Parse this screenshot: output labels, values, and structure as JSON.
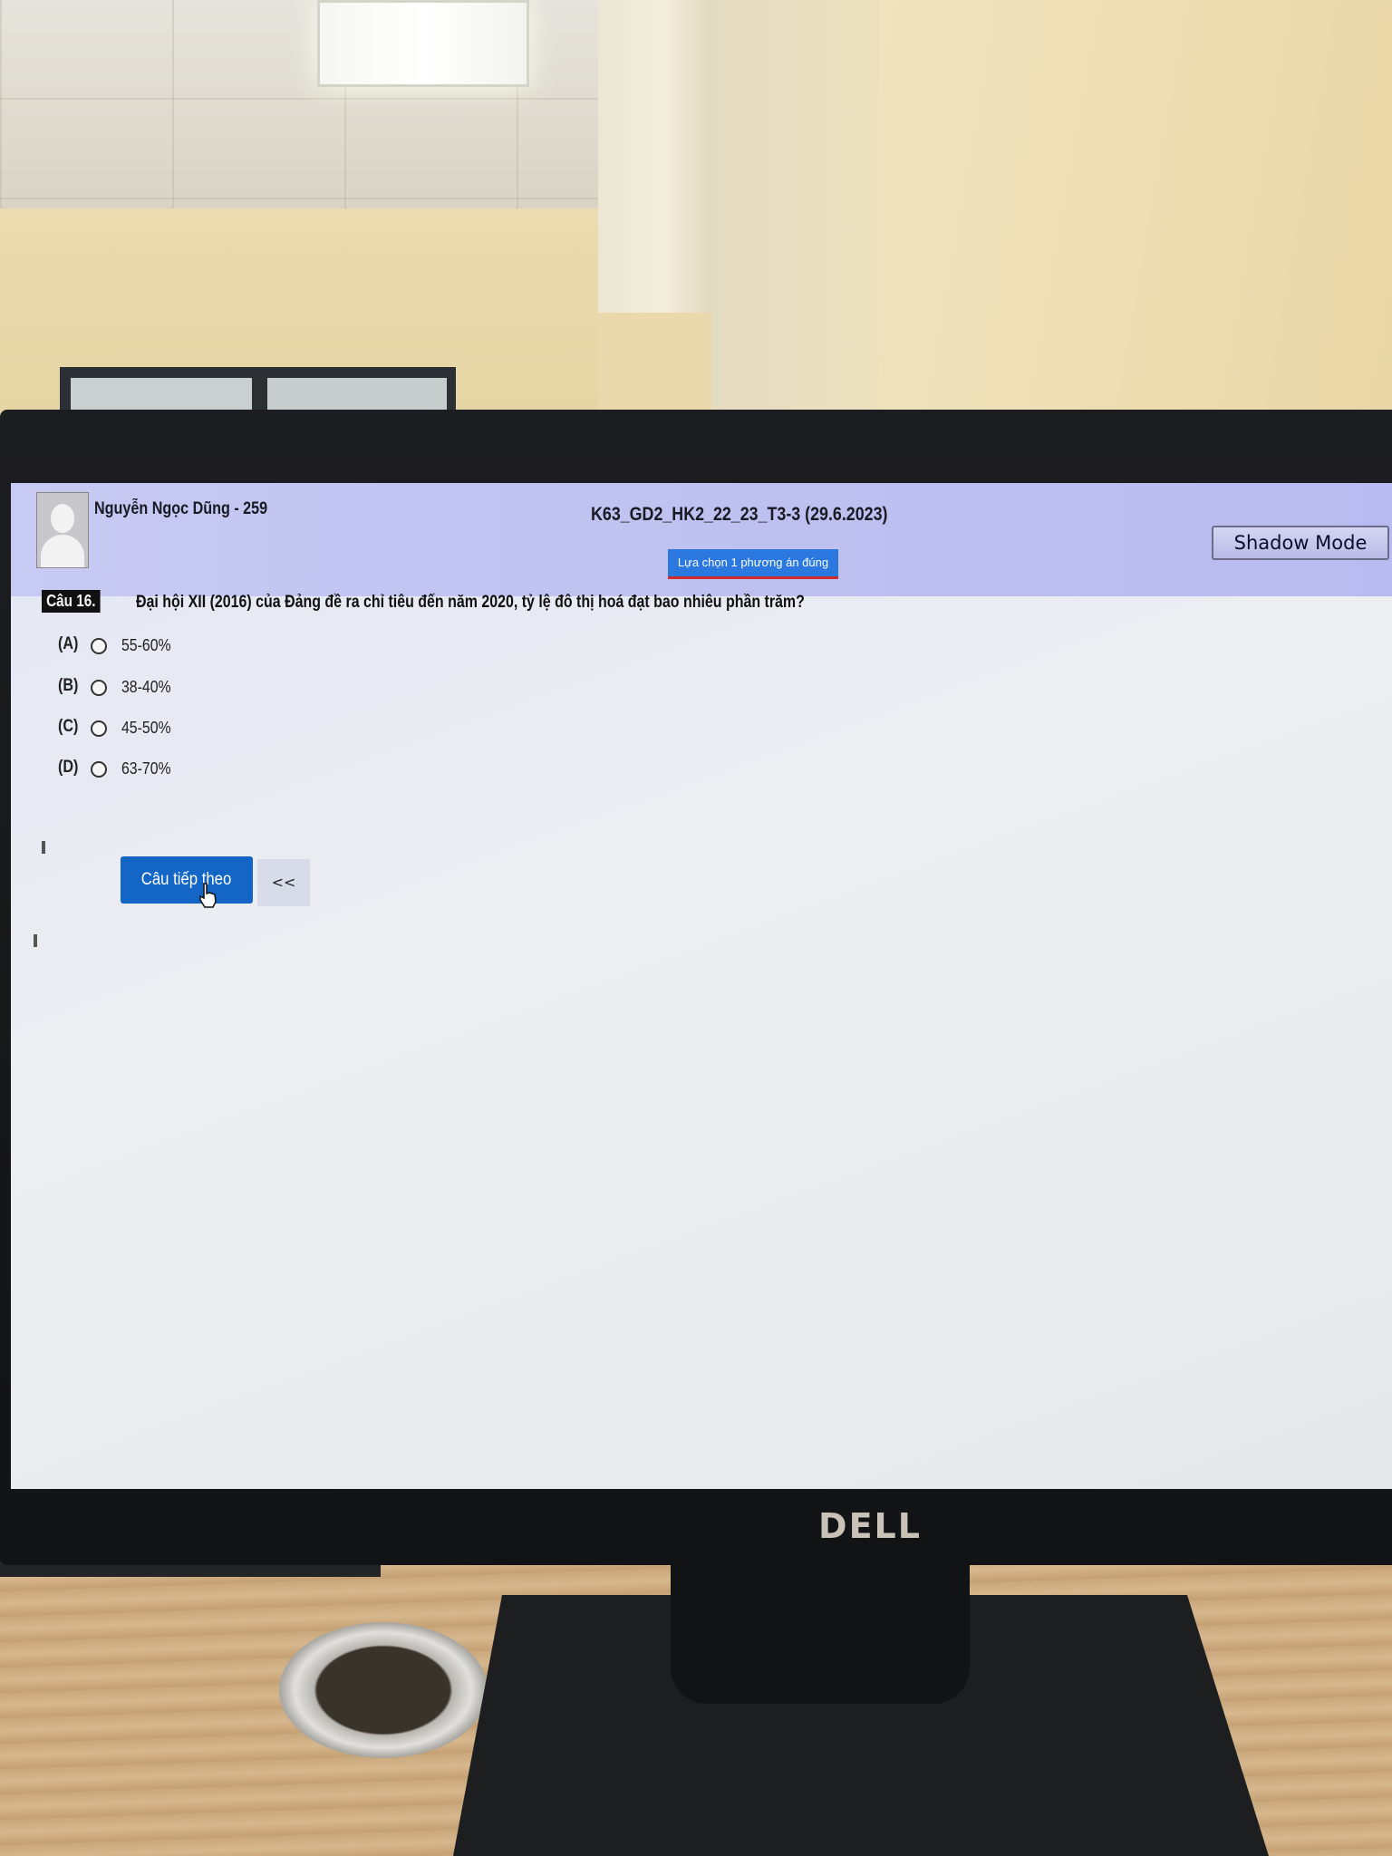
{
  "header": {
    "user_name": "Nguyễn Ngọc Dũng - 259",
    "exam_title": "K63_GD2_HK2_22_23_T3-3 (29.6.2023)",
    "instruction": "Lựa chọn 1 phương án đúng",
    "shadow_mode_label": "Shadow Mode"
  },
  "question": {
    "number_label": "Câu 16.",
    "text": "Đại hội XII (2016) của Đảng đề ra chỉ tiêu đến năm 2020, tỷ lệ đô thị hoá đạt bao nhiêu phần trăm?",
    "options": [
      {
        "letter": "(A)",
        "value": "55-60%"
      },
      {
        "letter": "(B)",
        "value": "38-40%"
      },
      {
        "letter": "(C)",
        "value": "45-50%"
      },
      {
        "letter": "(D)",
        "value": "63-70%"
      }
    ]
  },
  "navigation": {
    "next_label": "Câu tiếp theo",
    "prev_label": "<<"
  },
  "monitor": {
    "brand": "DELL"
  },
  "colors": {
    "header_bg": "#c3c6f2",
    "next_button": "#1366c6",
    "instruction_badge": "#2a78e0"
  }
}
